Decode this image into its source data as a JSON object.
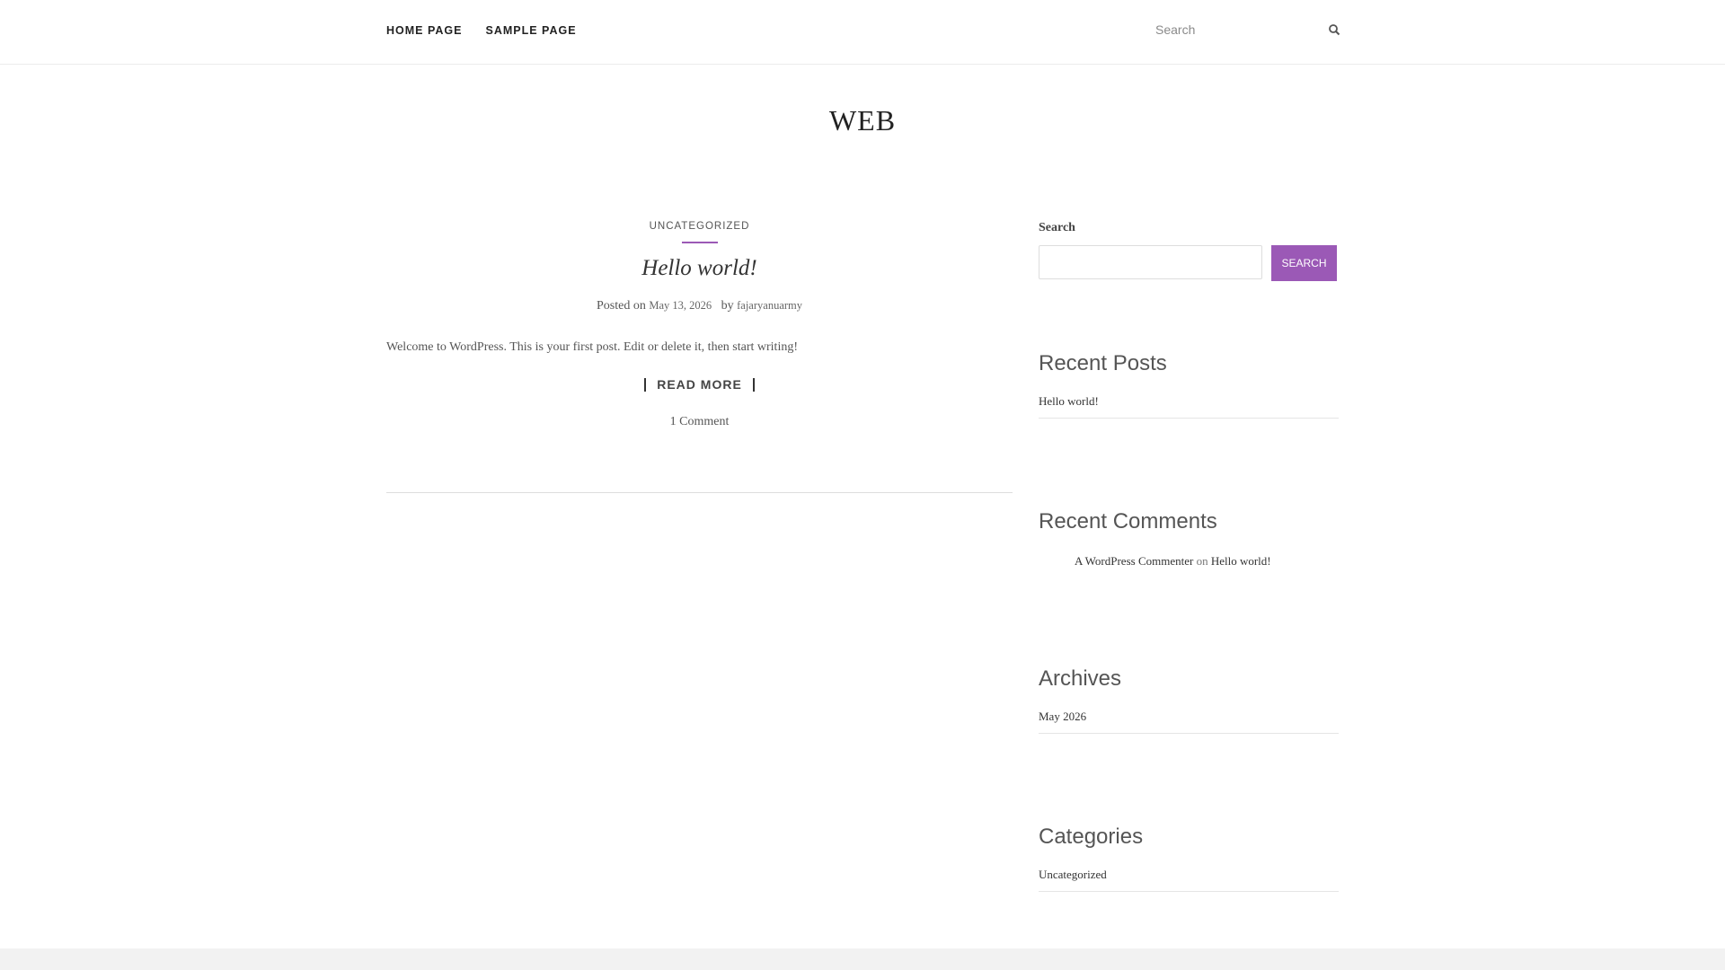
{
  "nav": {
    "items": [
      {
        "label": "HOME PAGE"
      },
      {
        "label": "SAMPLE PAGE"
      }
    ]
  },
  "header_search": {
    "placeholder": "Search",
    "icon": "search-icon"
  },
  "site": {
    "title": "WEB"
  },
  "post": {
    "category": "UNCATEGORIZED",
    "title": "Hello world!",
    "posted_on_label": "Posted on",
    "date": "May 13, 2026",
    "by_label": "by",
    "author": "fajaryanuarmy",
    "excerpt": "Welcome to WordPress. This is your first post. Edit or delete it, then start writing!",
    "read_more": "READ MORE",
    "comments": "1 Comment"
  },
  "sidebar": {
    "search": {
      "label": "Search",
      "button": "SEARCH"
    },
    "recent_posts": {
      "title": "Recent Posts",
      "items": [
        "Hello world!"
      ]
    },
    "recent_comments": {
      "title": "Recent Comments",
      "author": "A WordPress Commenter",
      "on": "on",
      "post": "Hello world!"
    },
    "archives": {
      "title": "Archives",
      "items": [
        "May 2026"
      ]
    },
    "categories": {
      "title": "Categories",
      "items": [
        "Uncategorized"
      ]
    }
  },
  "colors": {
    "accent": "#9b59b6",
    "footer_band": "#f2f2f2"
  }
}
